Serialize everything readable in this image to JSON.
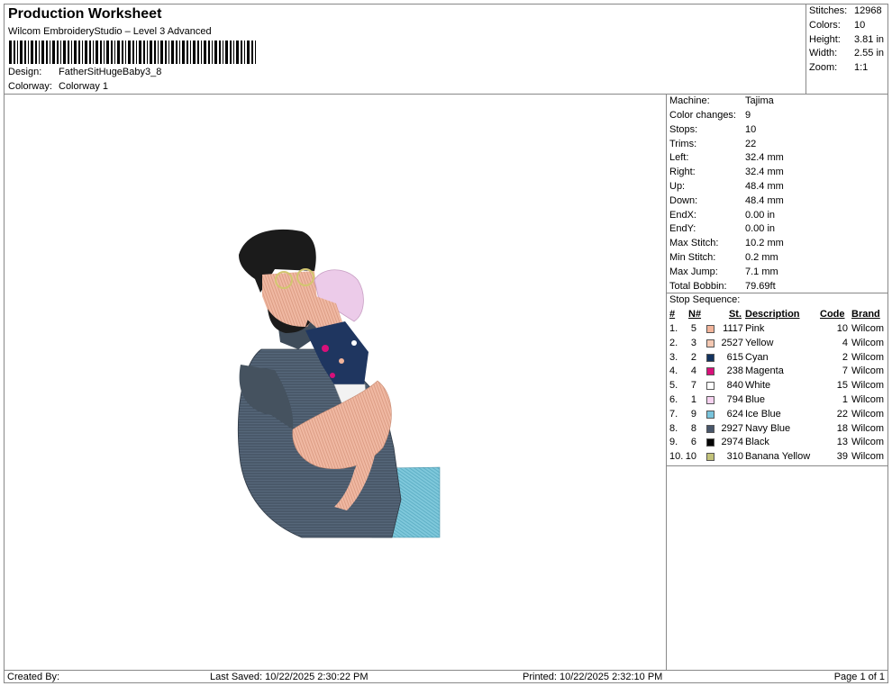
{
  "header": {
    "title": "Production Worksheet",
    "software": "Wilcom EmbroideryStudio – Level 3 Advanced",
    "design_label": "Design:",
    "design_value": "FatherSitHugeBaby3_8",
    "colorway_label": "Colorway:",
    "colorway_value": "Colorway 1"
  },
  "stats": [
    {
      "k": "Stitches:",
      "v": "12968"
    },
    {
      "k": "Colors:",
      "v": "10"
    },
    {
      "k": "Height:",
      "v": "3.81 in"
    },
    {
      "k": "Width:",
      "v": "2.55 in"
    },
    {
      "k": "Zoom:",
      "v": "1:1"
    }
  ],
  "info": [
    {
      "k": "Machine:",
      "v": "Tajima"
    },
    {
      "k": "Color changes:",
      "v": "9"
    },
    {
      "k": "Stops:",
      "v": "10"
    },
    {
      "k": "Trims:",
      "v": "22"
    },
    {
      "k": "Left:",
      "v": "32.4 mm"
    },
    {
      "k": "Right:",
      "v": "32.4 mm"
    },
    {
      "k": "Up:",
      "v": "48.4 mm"
    },
    {
      "k": "Down:",
      "v": "48.4 mm"
    },
    {
      "k": "EndX:",
      "v": "0.00 in"
    },
    {
      "k": "EndY:",
      "v": "0.00 in"
    },
    {
      "k": "Max Stitch:",
      "v": "10.2 mm"
    },
    {
      "k": "Min Stitch:",
      "v": "0.2 mm"
    },
    {
      "k": "Max Jump:",
      "v": "7.1 mm"
    },
    {
      "k": "Total Bobbin:",
      "v": "79.69ft"
    }
  ],
  "stop_sequence": {
    "label": "Stop Sequence:",
    "headers": {
      "num": "#",
      "needle": "N#",
      "stitches": "St.",
      "description": "Description",
      "code": "Code",
      "brand": "Brand"
    },
    "rows": [
      {
        "num": "1.",
        "needle": "5",
        "color": "#f2b49a",
        "stitches": "1117",
        "description": "Pink",
        "code": "10",
        "brand": "Wilcom"
      },
      {
        "num": "2.",
        "needle": "3",
        "color": "#f4c8b2",
        "stitches": "2527",
        "description": "Yellow",
        "code": "4",
        "brand": "Wilcom"
      },
      {
        "num": "3.",
        "needle": "2",
        "color": "#13335f",
        "stitches": "615",
        "description": "Cyan",
        "code": "2",
        "brand": "Wilcom"
      },
      {
        "num": "4.",
        "needle": "4",
        "color": "#d8107a",
        "stitches": "238",
        "description": "Magenta",
        "code": "7",
        "brand": "Wilcom"
      },
      {
        "num": "5.",
        "needle": "7",
        "color": "#ffffff",
        "stitches": "840",
        "description": "White",
        "code": "15",
        "brand": "Wilcom"
      },
      {
        "num": "6.",
        "needle": "1",
        "color": "#f6d2f0",
        "stitches": "794",
        "description": "Blue",
        "code": "1",
        "brand": "Wilcom"
      },
      {
        "num": "7.",
        "needle": "9",
        "color": "#79c4dc",
        "stitches": "624",
        "description": "Ice Blue",
        "code": "22",
        "brand": "Wilcom"
      },
      {
        "num": "8.",
        "needle": "8",
        "color": "#48566a",
        "stitches": "2927",
        "description": "Navy Blue",
        "code": "18",
        "brand": "Wilcom"
      },
      {
        "num": "9.",
        "needle": "6",
        "color": "#050505",
        "stitches": "2974",
        "description": "Black",
        "code": "13",
        "brand": "Wilcom"
      },
      {
        "num": "10.",
        "needle": "10",
        "color": "#c2c27a",
        "stitches": "310",
        "description": "Banana Yellow",
        "code": "39",
        "brand": "Wilcom"
      }
    ]
  },
  "footer": {
    "created": "Created By:",
    "saved": "Last Saved: 10/22/2025 2:30:22 PM",
    "printed": "Printed: 10/22/2025 2:32:10 PM",
    "page": "Page 1 of 1"
  }
}
